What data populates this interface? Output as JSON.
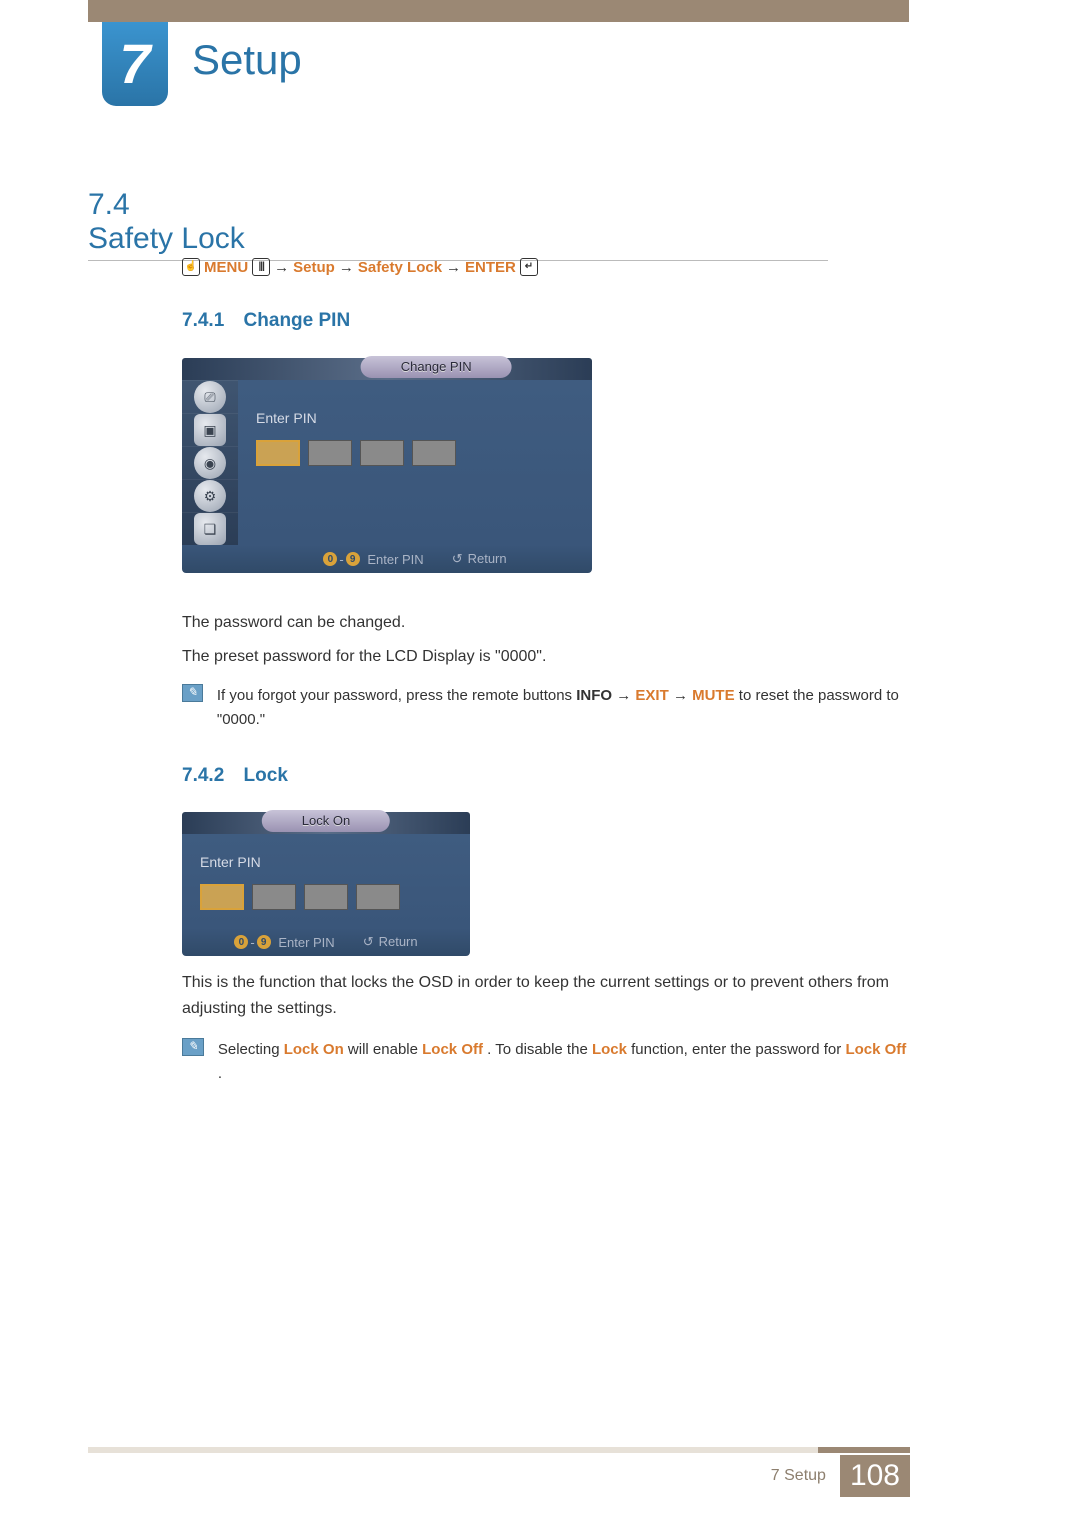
{
  "chapter": {
    "number": "7",
    "title": "Setup"
  },
  "section": {
    "number": "7.4",
    "title": "Safety Lock"
  },
  "breadcrumb": {
    "menu": "MENU",
    "step1": "Setup",
    "step2": "Safety Lock",
    "enter": "ENTER",
    "arrow": "→"
  },
  "subsections": {
    "s741": {
      "number": "7.4.1",
      "title": "Change PIN"
    },
    "s742": {
      "number": "7.4.2",
      "title": "Lock"
    }
  },
  "osd1": {
    "title": "Change PIN",
    "enter_pin": "Enter PIN",
    "footer_enter": "Enter PIN",
    "footer_return": "Return",
    "num0": "0",
    "num9": "9"
  },
  "osd2": {
    "title": "Lock On",
    "enter_pin": "Enter PIN",
    "footer_enter": "Enter PIN",
    "footer_return": "Return",
    "num0": "0",
    "num9": "9"
  },
  "body": {
    "p1": "The password can be changed.",
    "p2": "The preset password for the LCD Display is \"0000\".",
    "p3": "This is the function that locks the OSD in order to keep the current settings or to prevent others from adjusting the settings."
  },
  "note1": {
    "pre": "If you forgot your password, press the remote buttons ",
    "info": "INFO",
    "exit": "EXIT",
    "mute": "MUTE",
    "post": " to reset the password to \"0000.\"",
    "arrow": "→"
  },
  "note2": {
    "t1": "Selecting ",
    "lock_on": "Lock On",
    "t2": " will enable ",
    "lock_off1": "Lock Off",
    "t3": ". To disable the ",
    "lock": "Lock",
    "t4": " function, enter the password for ",
    "lock_off2": "Lock Off",
    "t5": "."
  },
  "footer": {
    "chapter_label": "7 Setup",
    "page": "108"
  }
}
